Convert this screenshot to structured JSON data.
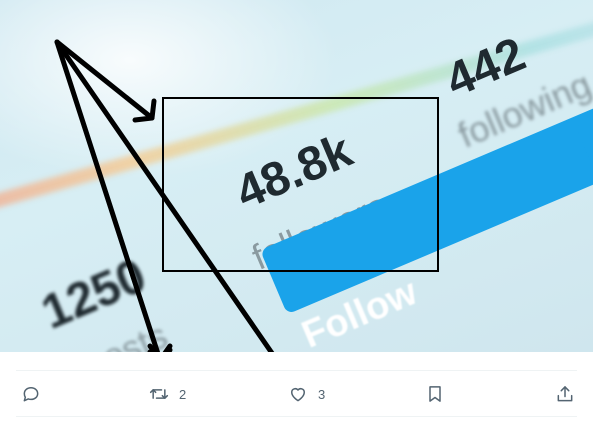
{
  "image": {
    "posts_count": "1250",
    "posts_label": "posts",
    "followers_count": "48.8k",
    "followers_label": "followers",
    "following_count": "442",
    "following_label": "following",
    "follow_button_label": "Follow"
  },
  "actions": {
    "reply": {
      "icon": "reply-icon",
      "count": ""
    },
    "retweet": {
      "icon": "retweet-icon",
      "count": "2"
    },
    "like": {
      "icon": "heart-icon",
      "count": "3"
    },
    "bookmark": {
      "icon": "bookmark-icon"
    },
    "share": {
      "icon": "share-icon"
    }
  },
  "colors": {
    "action_gray": "#536471",
    "follow_blue": "#1aa3ea",
    "annotation": "#000000"
  }
}
